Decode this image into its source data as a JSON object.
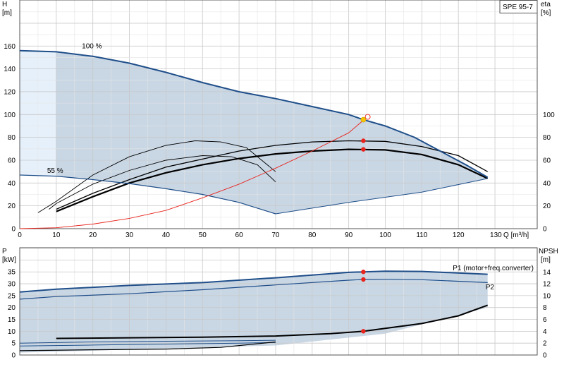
{
  "chart_data": [
    {
      "type": "line",
      "id": "head",
      "model_label": "SPE 95-7",
      "y_left_label": [
        "H",
        "[m]"
      ],
      "y_right_label": [
        "eta",
        "[%]"
      ],
      "x_label": "Q [m³/h]",
      "xlim": [
        0,
        135
      ],
      "ylim": [
        0,
        180
      ],
      "y_right_lim": [
        0,
        180
      ],
      "x_ticks": [
        0,
        10,
        20,
        30,
        40,
        50,
        60,
        70,
        80,
        90,
        100,
        110,
        120,
        130
      ],
      "y_ticks": [
        0,
        20,
        40,
        60,
        80,
        100,
        120,
        140,
        160
      ],
      "y_right_ticks": [
        0,
        20,
        40,
        60,
        80,
        100
      ],
      "grid": true,
      "annotations": [
        "100 %",
        "55 %"
      ],
      "colors": {
        "pump_curve": "#1f4e89",
        "region_fill": "#c9d7e5",
        "region_fill_light": "#e6f0fa",
        "system_curve": "#e8241c",
        "efficiency": "#000000",
        "op_point": "#f5c400"
      },
      "series": [
        {
          "role": "h_100",
          "points": [
            [
              0,
              156
            ],
            [
              10,
              155
            ],
            [
              20,
              151
            ],
            [
              30,
              145
            ],
            [
              40,
              137
            ],
            [
              50,
              128
            ],
            [
              60,
              120
            ],
            [
              70,
              114
            ],
            [
              80,
              107
            ],
            [
              90,
              100
            ],
            [
              94,
              95.5
            ],
            [
              100,
              90
            ],
            [
              108,
              80
            ],
            [
              115,
              68
            ],
            [
              122,
              56
            ],
            [
              128,
              45
            ]
          ]
        },
        {
          "role": "h_55",
          "points": [
            [
              0,
              47
            ],
            [
              10,
              46
            ],
            [
              20,
              43
            ],
            [
              30,
              39.5
            ],
            [
              40,
              35
            ],
            [
              50,
              30
            ],
            [
              60,
              23
            ],
            [
              70,
              13
            ]
          ]
        },
        {
          "role": "region_bottom",
          "points": [
            [
              70,
              13
            ],
            [
              90,
              23
            ],
            [
              110,
              32
            ],
            [
              128,
              44
            ]
          ]
        },
        {
          "role": "system",
          "points": [
            [
              0,
              0
            ],
            [
              10,
              0.8
            ],
            [
              20,
              4
            ],
            [
              30,
              9
            ],
            [
              40,
              16
            ],
            [
              50,
              27
            ],
            [
              60,
              39
            ],
            [
              70,
              53
            ],
            [
              80,
              68
            ],
            [
              90,
              84
            ],
            [
              94,
              95
            ]
          ]
        },
        {
          "role": "eta_a",
          "points": [
            [
              5,
              14
            ],
            [
              10,
              24
            ],
            [
              20,
              47
            ],
            [
              30,
              63
            ],
            [
              40,
              73
            ],
            [
              48,
              77
            ],
            [
              55,
              76
            ],
            [
              62,
              71
            ],
            [
              70,
              50
            ]
          ]
        },
        {
          "role": "eta_b",
          "points": [
            [
              8,
              17
            ],
            [
              10,
              22
            ],
            [
              20,
              39
            ],
            [
              30,
              51
            ],
            [
              40,
              60
            ],
            [
              50,
              64
            ],
            [
              58,
              63
            ],
            [
              65,
              56
            ],
            [
              70,
              41
            ]
          ]
        },
        {
          "role": "eta_c",
          "points": [
            [
              10,
              17
            ],
            [
              20,
              31
            ],
            [
              30,
              43
            ],
            [
              40,
              54
            ],
            [
              50,
              61
            ],
            [
              60,
              68
            ],
            [
              70,
              73
            ],
            [
              80,
              76
            ],
            [
              90,
              77
            ],
            [
              100,
              76.5
            ],
            [
              110,
              72
            ],
            [
              120,
              64
            ],
            [
              128,
              50
            ]
          ]
        },
        {
          "role": "eta_d",
          "points": [
            [
              10,
              15
            ],
            [
              20,
              28
            ],
            [
              30,
              40
            ],
            [
              40,
              49
            ],
            [
              50,
              56
            ],
            [
              60,
              61.5
            ],
            [
              70,
              65.5
            ],
            [
              80,
              68
            ],
            [
              90,
              69.5
            ],
            [
              100,
              69
            ],
            [
              110,
              65
            ],
            [
              120,
              56
            ],
            [
              128,
              44
            ]
          ]
        }
      ],
      "operating_points": [
        {
          "x": 94,
          "y": 95.5,
          "kind": "duty"
        },
        {
          "x": 94,
          "y": 77,
          "kind": "marker"
        },
        {
          "x": 94,
          "y": 69.5,
          "kind": "marker"
        }
      ]
    },
    {
      "type": "line",
      "id": "power",
      "y_left_label": [
        "P",
        "[kW]"
      ],
      "y_right_label": [
        "NPSH",
        "[m]"
      ],
      "xlim": [
        0,
        135
      ],
      "ylim": [
        0,
        40
      ],
      "y_right_lim": [
        0,
        16
      ],
      "y_ticks": [
        0,
        5,
        10,
        15,
        20,
        25,
        30,
        35
      ],
      "y_right_ticks": [
        0,
        2,
        4,
        6,
        8,
        10,
        12,
        14
      ],
      "grid": true,
      "legend": [
        "P1 (motor+freq.converter)",
        "P2"
      ],
      "series": [
        {
          "role": "p1",
          "points": [
            [
              0,
              26.5
            ],
            [
              10,
              27.7
            ],
            [
              30,
              29.3
            ],
            [
              50,
              30.5
            ],
            [
              70,
              32.5
            ],
            [
              90,
              34.8
            ],
            [
              94,
              35
            ],
            [
              100,
              35.3
            ],
            [
              110,
              35.2
            ],
            [
              128,
              34
            ]
          ]
        },
        {
          "role": "p2",
          "points": [
            [
              0,
              23.5
            ],
            [
              10,
              24.6
            ],
            [
              30,
              25.8
            ],
            [
              50,
              27.5
            ],
            [
              70,
              29.5
            ],
            [
              90,
              31.5
            ],
            [
              94,
              31.8
            ],
            [
              100,
              31.9
            ],
            [
              110,
              31.7
            ],
            [
              128,
              30.5
            ]
          ]
        },
        {
          "role": "npsh",
          "points": [
            [
              10,
              2.8
            ],
            [
              30,
              2.9
            ],
            [
              50,
              3
            ],
            [
              70,
              3.2
            ],
            [
              85,
              3.6
            ],
            [
              94,
              4
            ],
            [
              100,
              4.5
            ],
            [
              110,
              5.3
            ],
            [
              120,
              6.6
            ],
            [
              128,
              8.4
            ]
          ]
        },
        {
          "role": "p_55_a",
          "points": [
            [
              0,
              5
            ],
            [
              20,
              5.5
            ],
            [
              40,
              5.8
            ],
            [
              60,
              6
            ],
            [
              70,
              6.2
            ]
          ]
        },
        {
          "role": "p_55_b",
          "points": [
            [
              0,
              3.8
            ],
            [
              20,
              4.2
            ],
            [
              40,
              4.6
            ],
            [
              60,
              5
            ],
            [
              70,
              5.3
            ]
          ]
        },
        {
          "role": "p_55_c",
          "points": [
            [
              0,
              1.8
            ],
            [
              20,
              2.2
            ],
            [
              40,
              2.5
            ],
            [
              55,
              3.2
            ],
            [
              70,
              5.5
            ]
          ]
        }
      ],
      "region_top": [
        [
          0,
          26.5
        ],
        [
          128,
          34
        ]
      ],
      "region_bottom": [
        [
          0,
          1
        ],
        [
          70,
          4
        ],
        [
          100,
          9
        ],
        [
          128,
          20
        ]
      ],
      "operating_points": [
        {
          "x": 94,
          "y": 35
        },
        {
          "x": 94,
          "y": 31.8
        },
        {
          "x": 94,
          "y": 10
        }
      ]
    }
  ]
}
